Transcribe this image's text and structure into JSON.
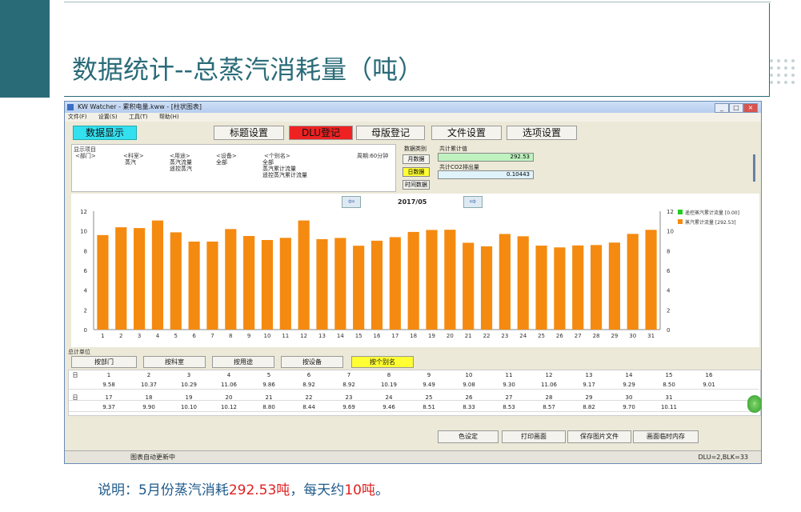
{
  "slide": {
    "title": "数据统计--总蒸汽消耗量（吨）",
    "caption_parts": [
      "说明：5月份蒸汽消耗",
      "292.53吨",
      "，每天约",
      "10吨",
      "。"
    ]
  },
  "window": {
    "title": "KW Watcher - 累积电量.kww - [柱状图表]",
    "controls": [
      "_",
      "□",
      "×"
    ],
    "menu": [
      "文件(F)",
      "设置(S)",
      "工具(T)",
      "帮助(H)"
    ]
  },
  "toolbar": {
    "data_display": "数据显示",
    "tabs": [
      "标题设置",
      "DLU登记",
      "母版登记",
      "文件设置",
      "选项设置"
    ]
  },
  "selection": {
    "section_label": "显示项目",
    "dept_header": "<部门>",
    "room_header": "<科室>",
    "use_header": "<用途>",
    "device_header": "<设备>",
    "alias_header": "<个别名>",
    "period": "周期:60分钟",
    "room_value": "蒸汽",
    "use_values": [
      "蒸汽流量",
      "遥控蒸汽"
    ],
    "device_value": "全部",
    "alias_values": [
      "全部",
      "蒸汽累计流量",
      "遥控蒸汽累计流量"
    ],
    "data_type_label": "数据类别",
    "data_type_buttons": [
      "月数据",
      "日数据",
      "时间数据"
    ],
    "total_label": "共计累计值",
    "total_value": "292.53",
    "co2_label": "共计CO2排出量",
    "co2_value": "0.10443"
  },
  "chart_data": {
    "type": "bar",
    "title": "2017/05",
    "categories": [
      "1",
      "2",
      "3",
      "4",
      "5",
      "6",
      "7",
      "8",
      "9",
      "10",
      "11",
      "12",
      "13",
      "14",
      "15",
      "16",
      "17",
      "18",
      "19",
      "20",
      "21",
      "22",
      "23",
      "24",
      "25",
      "26",
      "27",
      "28",
      "29",
      "30",
      "31"
    ],
    "series": [
      {
        "name": "蒸汽累计流量 [292.53]",
        "color": "#f58a10",
        "values": [
          9.58,
          10.37,
          10.29,
          11.06,
          9.86,
          8.92,
          8.92,
          10.19,
          9.49,
          9.08,
          9.3,
          11.06,
          9.17,
          9.29,
          8.5,
          9.01,
          9.37,
          9.9,
          10.1,
          10.12,
          8.8,
          8.44,
          9.69,
          9.46,
          8.51,
          8.33,
          8.53,
          8.57,
          8.82,
          9.7,
          10.11
        ]
      },
      {
        "name": "遥控蒸汽累计流量 [0.00]",
        "color": "#22cc22",
        "values": [
          0,
          0,
          0,
          0,
          0,
          0,
          0,
          0,
          0,
          0,
          0,
          0,
          0,
          0,
          0,
          0,
          0,
          0,
          0,
          0,
          0,
          0,
          0,
          0,
          0,
          0,
          0,
          0,
          0,
          0,
          0
        ]
      }
    ],
    "ylim": [
      0,
      12
    ],
    "yticks": [
      "0",
      "2",
      "4",
      "6",
      "8",
      "10",
      "12"
    ],
    "grid": false,
    "legend_placement": "top-right"
  },
  "grouping": {
    "unit_label": "总计单位",
    "buttons": [
      "按部门",
      "按科室",
      "按用途",
      "按设备",
      "按个别名"
    ]
  },
  "table": {
    "row_label": "日",
    "days_1": [
      "1",
      "2",
      "3",
      "4",
      "5",
      "6",
      "7",
      "8",
      "9",
      "10",
      "11",
      "12",
      "13",
      "14",
      "15",
      "16"
    ],
    "vals_1": [
      "9.58",
      "10.37",
      "10.29",
      "11.06",
      "9.86",
      "8.92",
      "8.92",
      "10.19",
      "9.49",
      "9.08",
      "9.30",
      "11.06",
      "9.17",
      "9.29",
      "8.50",
      "9.01"
    ],
    "days_2": [
      "17",
      "18",
      "19",
      "20",
      "21",
      "22",
      "23",
      "24",
      "25",
      "26",
      "27",
      "28",
      "29",
      "30",
      "31"
    ],
    "vals_2": [
      "9.37",
      "9.90",
      "10.10",
      "10.12",
      "8.80",
      "8.44",
      "9.69",
      "9.46",
      "8.51",
      "8.33",
      "8.53",
      "8.57",
      "8.82",
      "9.70",
      "10.11"
    ]
  },
  "actions": [
    "色设定",
    "打印画面",
    "保存图片文件",
    "画面临时内存"
  ],
  "status": {
    "left": "图表自动更新中",
    "right": "DLU=2,BLK=33"
  },
  "colors": {
    "accent": "#2a6b78",
    "bar": "#f58a10",
    "highlight_red": "#ee2222",
    "highlight_yellow": "#ffff33",
    "cyan": "#33e0f0"
  }
}
